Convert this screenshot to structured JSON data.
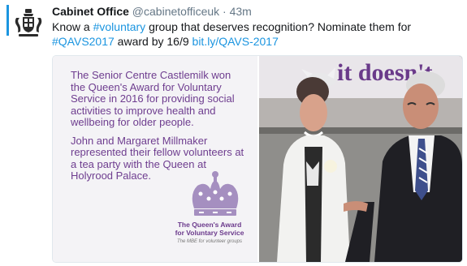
{
  "tweet": {
    "author_name": "Cabinet Office",
    "author_handle": "@cabinetofficeuk",
    "separator": "·",
    "time": "43m",
    "text": {
      "part1": "Know a ",
      "hashtag_voluntary": "#voluntary",
      "part2": " group that deserves recognition? Nominate them for ",
      "hashtag_qavs": "#QAVS2017",
      "part3": " award by 16/9 ",
      "link": "bit.ly/QAVS-2017"
    }
  },
  "media": {
    "card": {
      "paragraph1": "The Senior Centre Castlemilk won the Queen's Award for Voluntary Service in 2016 for providing social activities to improve health and wellbeing for older people.",
      "paragraph2": "John and Margaret Millmaker represented their fellow volunteers at a tea party with the Queen at Holyrood Palace.",
      "award_line1": "The Queen's Award",
      "award_line2": "for Voluntary Service",
      "award_subtitle": "The MBE for volunteer groups"
    },
    "photo": {
      "banner_text": "it doesn't"
    }
  },
  "colors": {
    "link": "#1b95e0",
    "card_text": "#6e3d8f",
    "thread_rail": "#1b95e0"
  },
  "icons": {
    "avatar": "royal-coat-of-arms-icon",
    "crown": "crown-icon"
  }
}
